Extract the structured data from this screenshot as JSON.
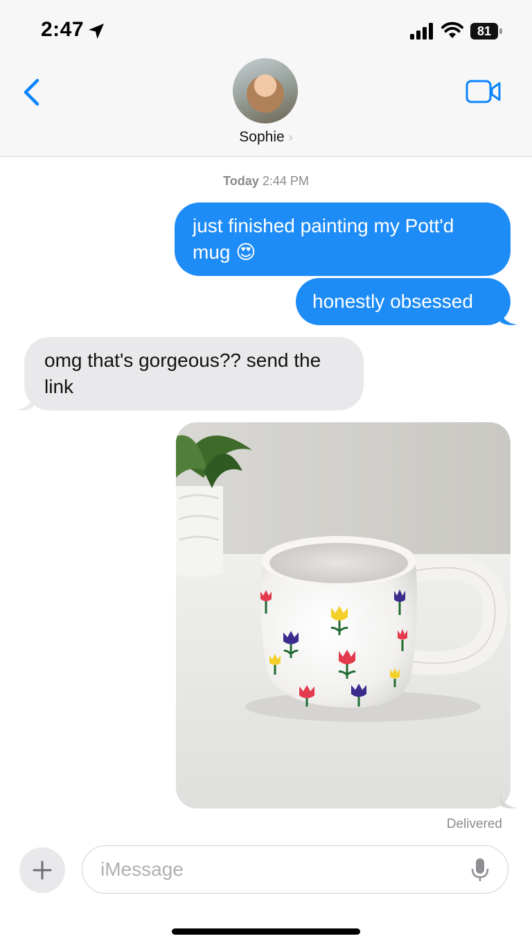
{
  "status_bar": {
    "time": "2:47",
    "battery": "81",
    "icons": [
      "location-arrow-icon",
      "cellular-signal-icon",
      "wifi-icon",
      "battery-icon"
    ]
  },
  "header": {
    "back_icon": "chevron-left-icon",
    "contact_name": "Sophie",
    "contact_chevron": "›",
    "video_icon": "video-camera-icon"
  },
  "thread": {
    "timestamp_day": "Today",
    "timestamp_time": "2:44 PM",
    "messages": [
      {
        "direction": "outgoing",
        "text": "just finished painting my Pott'd mug 😍"
      },
      {
        "direction": "outgoing",
        "text": "honestly obsessed"
      },
      {
        "direction": "incoming",
        "text": "omg that's gorgeous?? send the link"
      },
      {
        "direction": "outgoing",
        "type": "image",
        "alt": "photo"
      }
    ],
    "status": "Delivered"
  },
  "composer": {
    "plus_icon": "plus-icon",
    "placeholder": "iMessage",
    "value": "",
    "mic_icon": "microphone-icon"
  },
  "colors": {
    "outgoing_bubble": "#1e8cf6",
    "incoming_bubble": "#e9e9eb",
    "accent": "#0a84ff",
    "secondary_text": "#8a8a8e"
  }
}
